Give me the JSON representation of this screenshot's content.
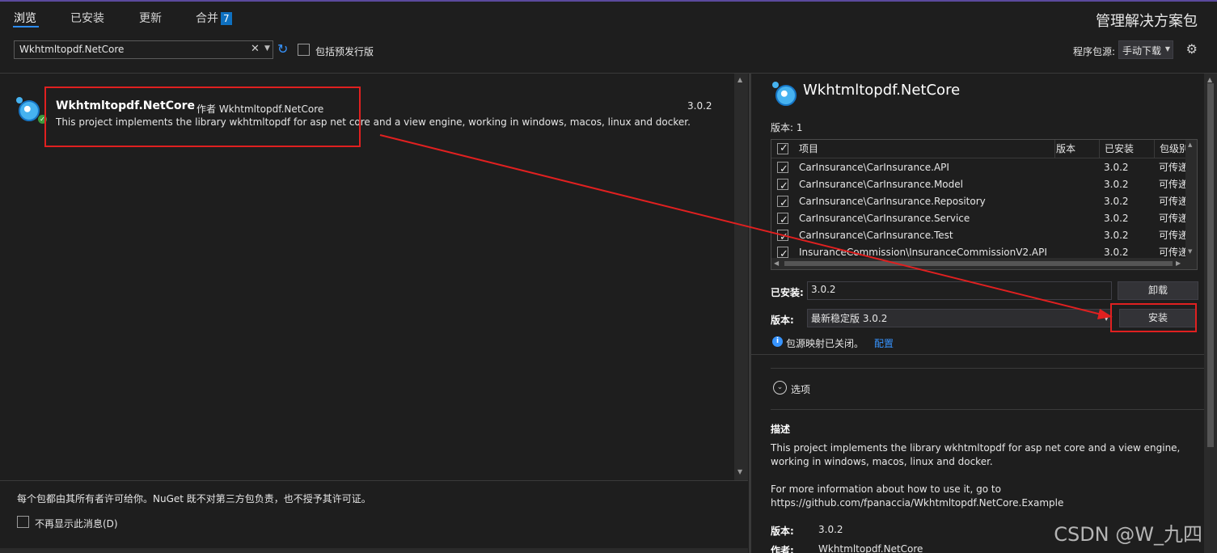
{
  "tabs": [
    {
      "label": "浏览"
    },
    {
      "label": "已安装"
    },
    {
      "label": "更新"
    },
    {
      "label": "合并",
      "badge": "7"
    }
  ],
  "header": {
    "title": "管理解决方案包",
    "source_label": "程序包源:",
    "source_value": "手动下载"
  },
  "search": {
    "value": "Wkhtmltopdf.NetCore",
    "prerelease_label": "包括预发行版"
  },
  "package_list": {
    "items": [
      {
        "name": "Wkhtmltopdf.NetCore",
        "author": "作者 Wkhtmltopdf.NetCore",
        "description": "This project implements the library wkhtmltopdf for asp net core and a view engine, working in windows, macos, linux and docker.",
        "version": "3.0.2"
      }
    ]
  },
  "license_note": "每个包都由其所有者许可给你。NuGet 既不对第三方包负责，也不授予其许可证。",
  "dont_show_label": "不再显示此消息(D)",
  "detail": {
    "name": "Wkhtmltopdf.NetCore",
    "version_count_label": "版本: 1",
    "table": {
      "headers": [
        "项目",
        "版本",
        "已安装",
        "包级别"
      ],
      "rows": [
        {
          "project": "CarInsurance\\CarInsurance.API",
          "version": "",
          "installed": "3.0.2",
          "level": "可传递"
        },
        {
          "project": "CarInsurance\\CarInsurance.Model",
          "version": "",
          "installed": "3.0.2",
          "level": "可传递"
        },
        {
          "project": "CarInsurance\\CarInsurance.Repository",
          "version": "",
          "installed": "3.0.2",
          "level": "可传递"
        },
        {
          "project": "CarInsurance\\CarInsurance.Service",
          "version": "",
          "installed": "3.0.2",
          "level": "可传递"
        },
        {
          "project": "CarInsurance\\CarInsurance.Test",
          "version": "",
          "installed": "3.0.2",
          "level": "可传递"
        },
        {
          "project": "InsuranceCommission\\InsuranceCommissionV2.API",
          "version": "",
          "installed": "3.0.2",
          "level": "可传递"
        }
      ]
    },
    "installed_label": "已安装:",
    "installed_value": "3.0.2",
    "uninstall_label": "卸载",
    "version_label": "版本:",
    "version_value": "最新稳定版 3.0.2",
    "install_label": "安装",
    "mapping_note": "包源映射已关闭。",
    "configure_label": "配置",
    "options_label": "选项",
    "desc_heading": "描述",
    "desc_p1": "This project implements the library wkhtmltopdf for asp net core and a view engine, working in windows, macos, linux and docker.",
    "desc_p2": "For more information about how to use it, go to https://github.com/fpanaccia/Wkhtmltopdf.NetCore.Example",
    "meta_version_label": "版本:",
    "meta_version_value": "3.0.2",
    "meta_author_label": "作者:",
    "meta_author_value": "Wkhtmltopdf.NetCore"
  },
  "watermark": "CSDN @W_九四"
}
